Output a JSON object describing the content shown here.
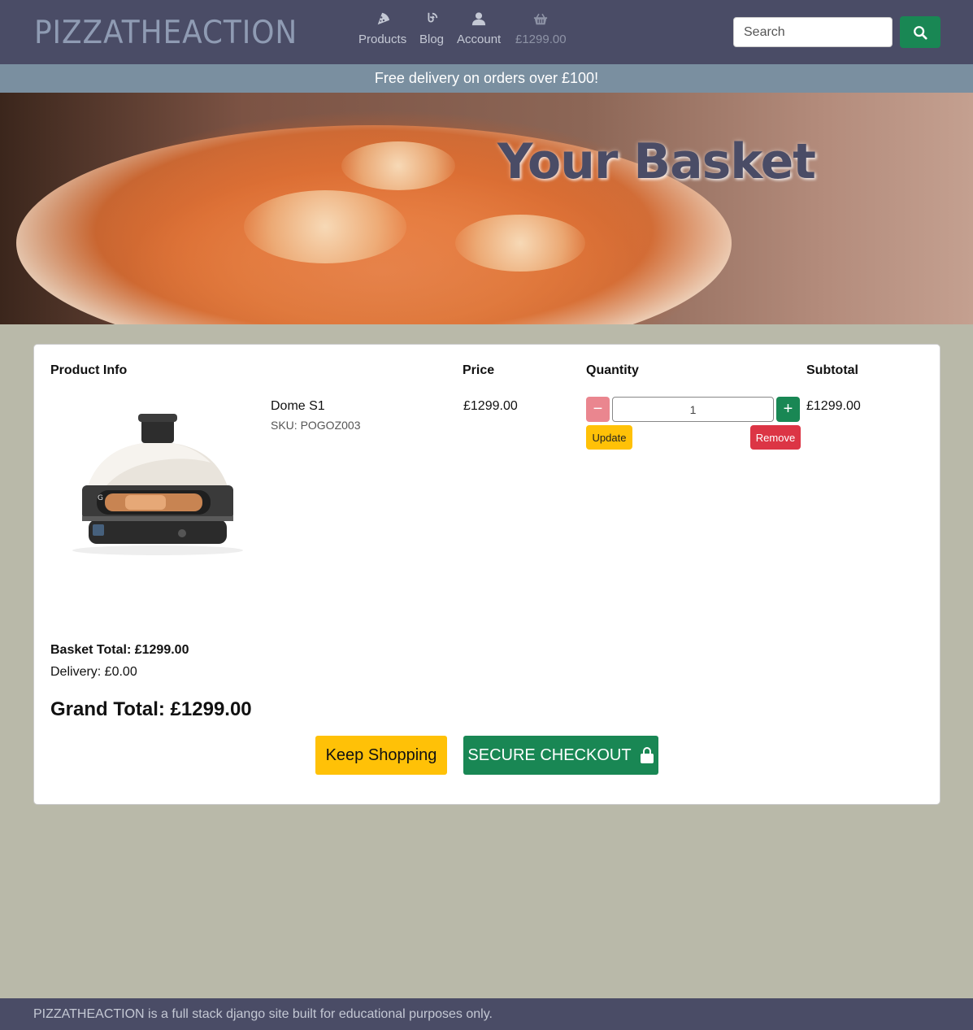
{
  "header": {
    "brand": "PIZZATHEACTION",
    "nav": {
      "products": "Products",
      "blog": "Blog",
      "account": "Account",
      "basket_total": "£1299.00"
    },
    "search_placeholder": "Search"
  },
  "promo": "Free delivery on orders over £100!",
  "hero": {
    "title": "Your Basket"
  },
  "table": {
    "headers": {
      "product_info": "Product Info",
      "price": "Price",
      "quantity": "Quantity",
      "subtotal": "Subtotal"
    },
    "items": [
      {
        "name": "Dome S1",
        "sku": "SKU: POGOZ003",
        "price": "£1299.00",
        "quantity": "1",
        "subtotal": "£1299.00",
        "update_label": "Update",
        "remove_label": "Remove",
        "minus_symbol": "−",
        "plus_symbol": "+"
      }
    ]
  },
  "totals": {
    "basket_total": "Basket Total: £1299.00",
    "delivery": "Delivery: £0.00",
    "grand_total": "Grand Total: £1299.00"
  },
  "actions": {
    "keep_shopping": "Keep Shopping",
    "secure_checkout": "SECURE CHECKOUT"
  },
  "footer": "PIZZATHEACTION is a full stack django site built for educational purposes only.",
  "colors": {
    "navbar": "#4a4c66",
    "promo": "#7a8fa0",
    "page_bg": "#b9b9a9",
    "success": "#198754",
    "warning": "#ffc107",
    "danger": "#dc3545"
  },
  "icons": {
    "products": "pizza-slice-icon",
    "blog": "blog-icon",
    "account": "user-icon",
    "basket": "shopping-basket-icon",
    "search": "search-icon",
    "checkout": "lock-icon"
  }
}
